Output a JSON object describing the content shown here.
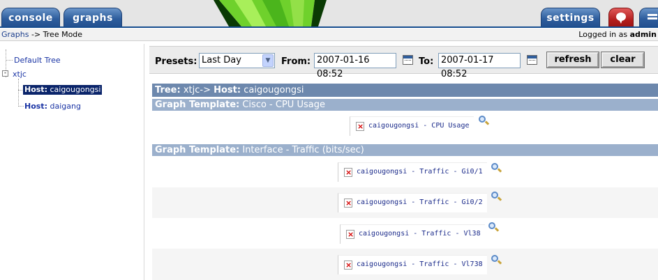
{
  "tabs": {
    "console": "console",
    "graphs": "graphs",
    "settings": "settings"
  },
  "breadcrumb": {
    "graphs_link": "Graphs",
    "separator": "->",
    "current": "Tree Mode"
  },
  "login": {
    "prefix": "Logged in as",
    "user": "admin"
  },
  "tree": {
    "default_tree": "Default Tree",
    "xtjc": "xtjc",
    "toggle": "-",
    "hosts": [
      {
        "prefix": "Host:",
        "name": "caigougongsi",
        "selected": true
      },
      {
        "prefix": "Host:",
        "name": "daigang",
        "selected": false
      }
    ]
  },
  "filter": {
    "presets_label": "Presets:",
    "presets_value": "Last Day",
    "from_label": "From:",
    "from_value": "2007-01-16 08:52",
    "to_label": "To:",
    "to_value": "2007-01-17 08:52",
    "refresh": "refresh",
    "clear": "clear"
  },
  "graph_view": {
    "tree_header_label": "Tree:",
    "tree_header_tree": "xtjc->",
    "tree_header_host_label": "Host:",
    "tree_header_host": "caigougongsi",
    "templates": [
      {
        "label": "Graph Template:",
        "name": "Cisco - CPU Usage",
        "graphs": [
          "caigougongsi - CPU Usage"
        ]
      },
      {
        "label": "Graph Template:",
        "name": "Interface - Traffic (bits/sec)",
        "graphs": [
          "caigougongsi - Traffic - Gi0/1",
          "caigougongsi - Traffic - Gi0/2",
          "caigougongsi - Traffic - Vl38",
          "caigougongsi - Traffic - Vl738"
        ]
      }
    ]
  },
  "colors": {
    "tab_blue": "#2d5c9c",
    "tree_header": "#6d88ad",
    "template_header": "#9bb0cc",
    "selected_node": "#0a246a",
    "link": "#1a34a4"
  },
  "icons": [
    "calendar-icon",
    "broken-image-icon",
    "zoom-icon",
    "dropdown-arrow-icon",
    "help-icon"
  ]
}
